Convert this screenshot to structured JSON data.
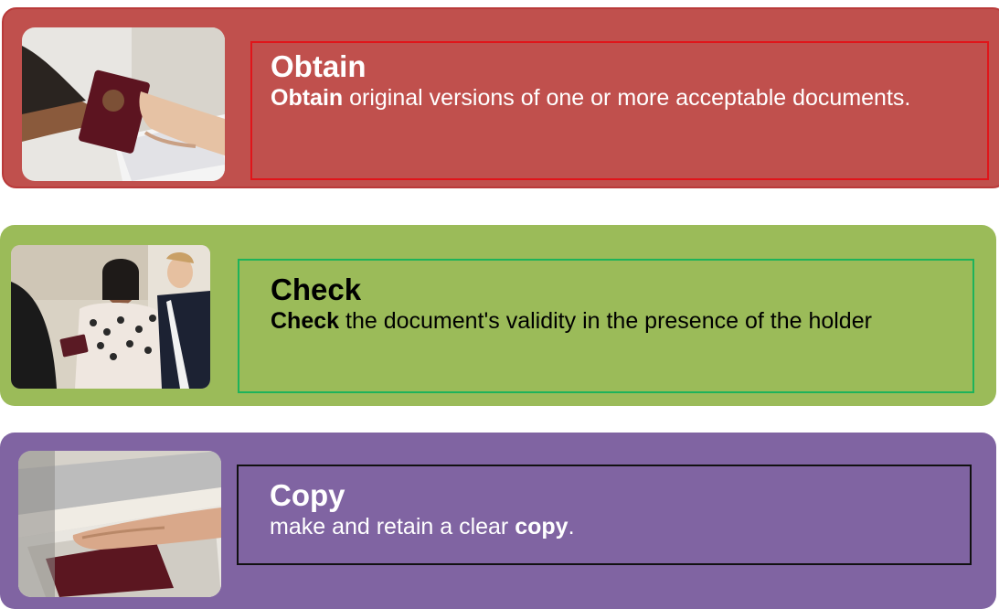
{
  "steps": [
    {
      "title": "Obtain",
      "body_bold": "Obtain",
      "body_text": " original versions of one or more acceptable documents.",
      "photo_icon": "passport-handover-photo"
    },
    {
      "title": "Check",
      "body_bold": "Check",
      "body_text": " the document's validity in the presence of the holder",
      "photo_icon": "document-check-photo"
    },
    {
      "title": "Copy",
      "body_prefix": "make and retain a clear ",
      "body_bold": "copy",
      "body_suffix": ".",
      "photo_icon": "photocopy-photo"
    }
  ],
  "colors": {
    "obtain": "#c0504d",
    "check": "#9bbb59",
    "copy": "#8064a2"
  }
}
